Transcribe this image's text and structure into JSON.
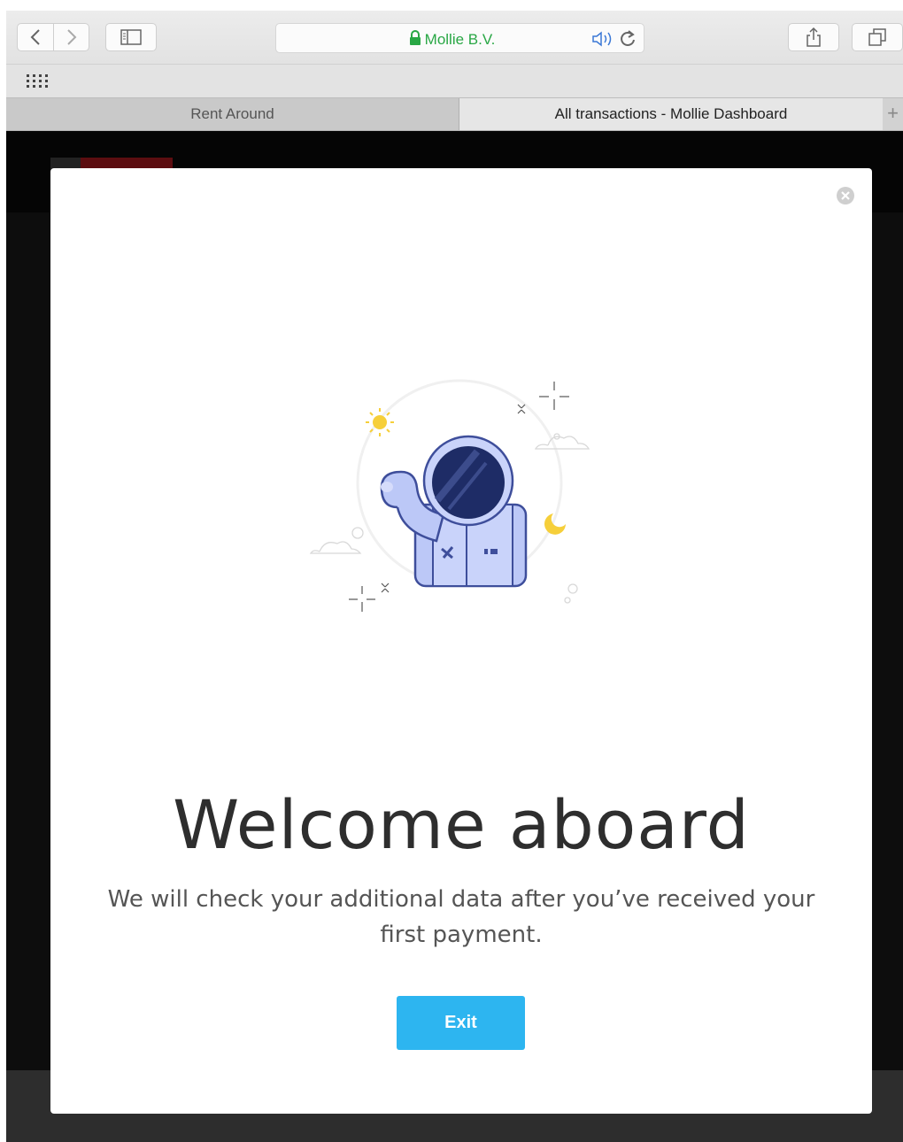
{
  "browser": {
    "address_bar": {
      "site_name": "Mollie B.V."
    },
    "tabs": [
      {
        "label": "Rent Around",
        "active": false
      },
      {
        "label": "All transactions - Mollie Dashboard",
        "active": true
      }
    ],
    "new_tab_label": "+",
    "icons": [
      "back-icon",
      "forward-icon",
      "sidebar-icon",
      "lock-icon",
      "audio-icon",
      "reload-icon",
      "share-icon",
      "tabs-overview-icon",
      "apps-grid-icon"
    ]
  },
  "modal": {
    "title": "Welcome aboard",
    "message": "We will check your additional data after you’ve received your first payment.",
    "exit_label": "Exit",
    "illustration": "astronaut-waving-illustration"
  },
  "colors": {
    "accent": "#2db5f0",
    "secure_green": "#29a745",
    "astronaut_suit": "#bcc8f7",
    "astronaut_outline": "#3e4e9b",
    "sun_yellow": "#f6cf3a"
  }
}
